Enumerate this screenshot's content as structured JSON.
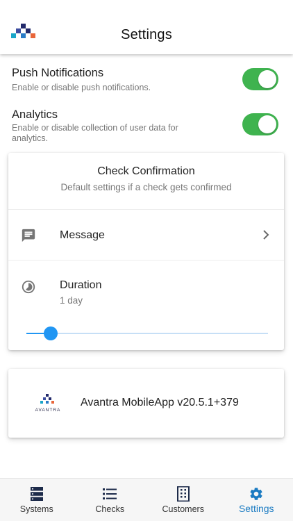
{
  "header": {
    "title": "Settings"
  },
  "settings": [
    {
      "title": "Push Notifications",
      "description": "Enable or disable push notifications.",
      "enabled": true
    },
    {
      "title": "Analytics",
      "description": "Enable or disable collection of user data for analytics.",
      "enabled": true
    }
  ],
  "check_confirmation": {
    "title": "Check Confirmation",
    "subtitle": "Default settings if a check gets confirmed",
    "message": {
      "label": "Message",
      "icon": "message-icon"
    },
    "duration": {
      "label": "Duration",
      "value": "1 day",
      "icon": "timelapse-icon",
      "slider_fraction": 0.1
    }
  },
  "about": {
    "logo_text": "AVANTRA",
    "version_text": "Avantra MobileApp v20.5.1+379"
  },
  "bottom_nav": {
    "items": [
      {
        "label": "Systems",
        "icon": "server-icon",
        "active": false
      },
      {
        "label": "Checks",
        "icon": "list-icon",
        "active": false
      },
      {
        "label": "Customers",
        "icon": "building-icon",
        "active": false
      },
      {
        "label": "Settings",
        "icon": "gear-icon",
        "active": true
      }
    ]
  },
  "colors": {
    "accent": "#2196f3",
    "toggle_on": "#3fb34f",
    "nav_active": "#1b7bc2"
  }
}
